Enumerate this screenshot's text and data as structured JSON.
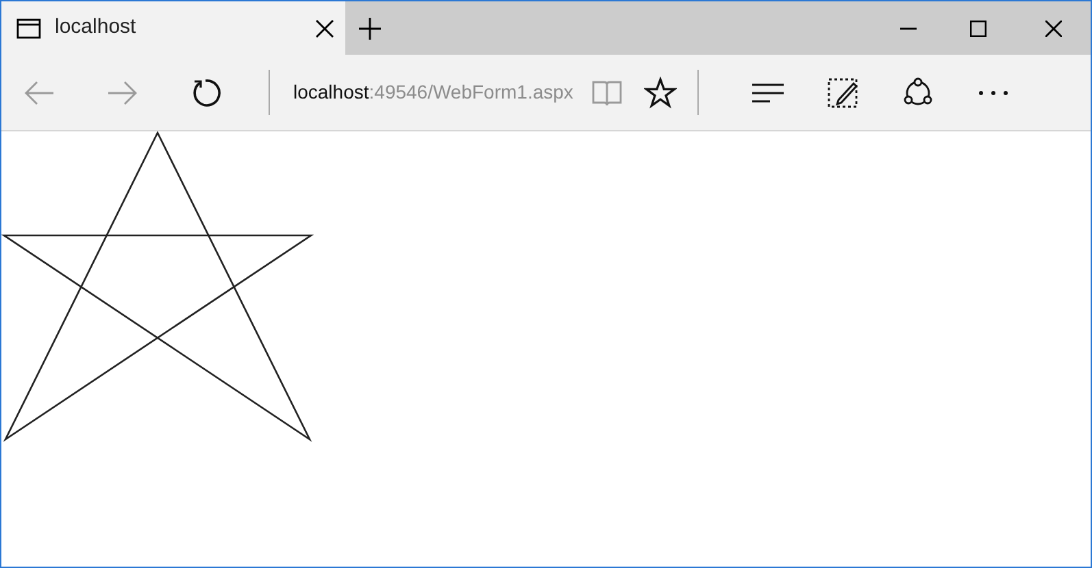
{
  "tab": {
    "title": "localhost"
  },
  "toolbar": {
    "back_disabled": true,
    "forward_disabled": true,
    "reading_view_disabled": true
  },
  "address": {
    "host": "localhost",
    "rest": ":49546/WebForm1.aspx"
  }
}
